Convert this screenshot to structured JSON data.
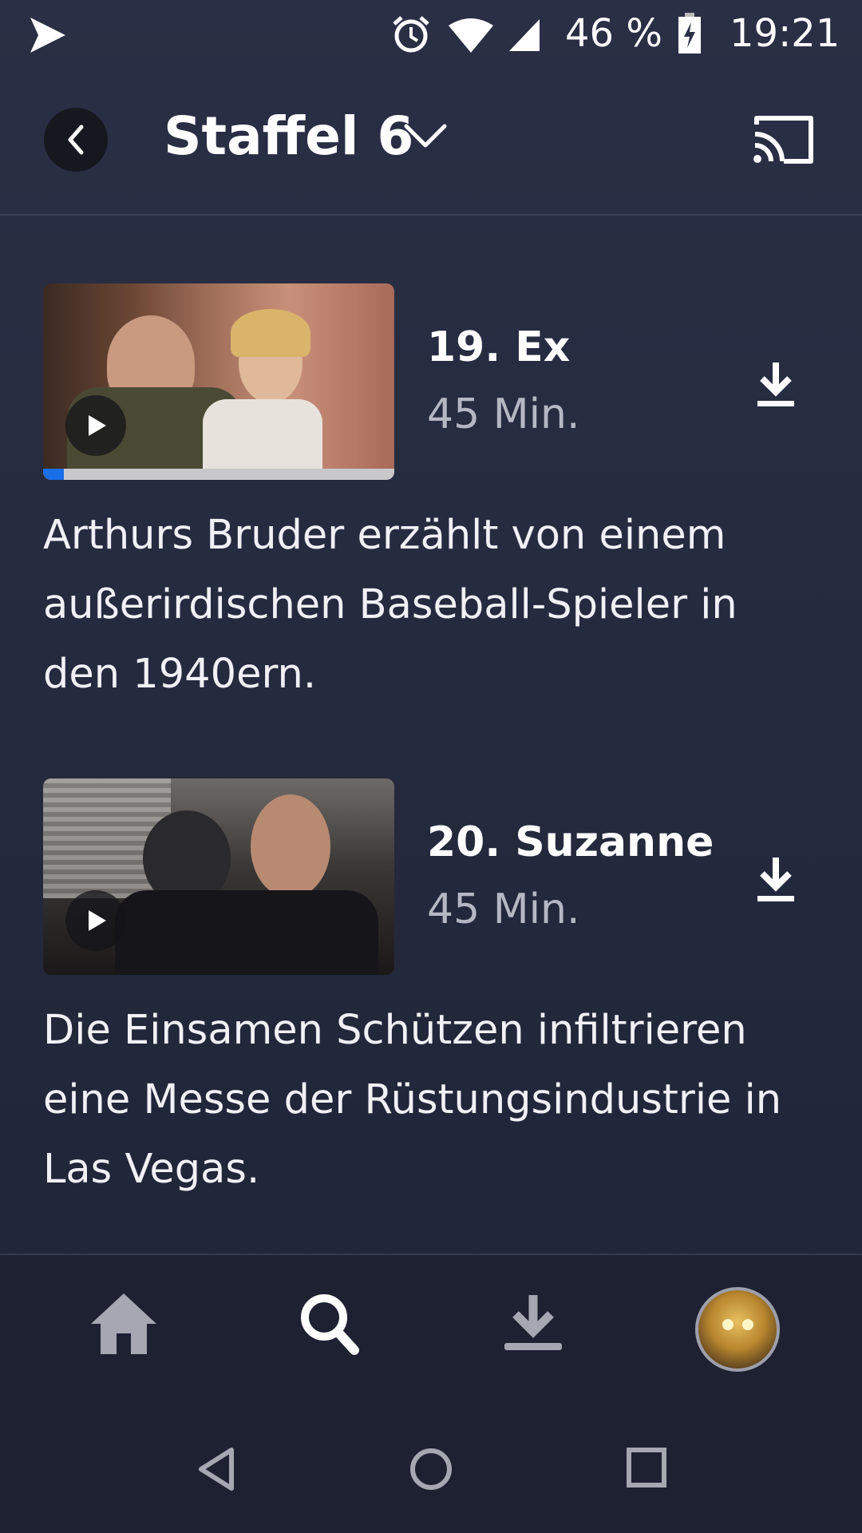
{
  "status_bar": {
    "battery": "46 %",
    "time": "19:21",
    "icons": [
      "play-store-icon",
      "alarm-icon",
      "wifi-icon",
      "cell-signal-icon",
      "battery-charging-icon"
    ]
  },
  "header": {
    "title": "Staffel 6"
  },
  "episodes": [
    {
      "title": "19. Ex",
      "duration": "45 Min.",
      "description": "Arthurs Bruder erzählt von einem außerirdischen Baseball-Spieler in den 1940ern.",
      "progress": 0.06
    },
    {
      "title": "20. Suzanne",
      "duration": "45 Min.",
      "description": "Die Einsamen Schützen infiltrieren eine Messe der Rüstungsindustrie in Las Vegas."
    }
  ],
  "colors": {
    "background": "#262b40",
    "accent_progress": "#1a6fe8",
    "secondary_text": "#b5b8c4"
  }
}
